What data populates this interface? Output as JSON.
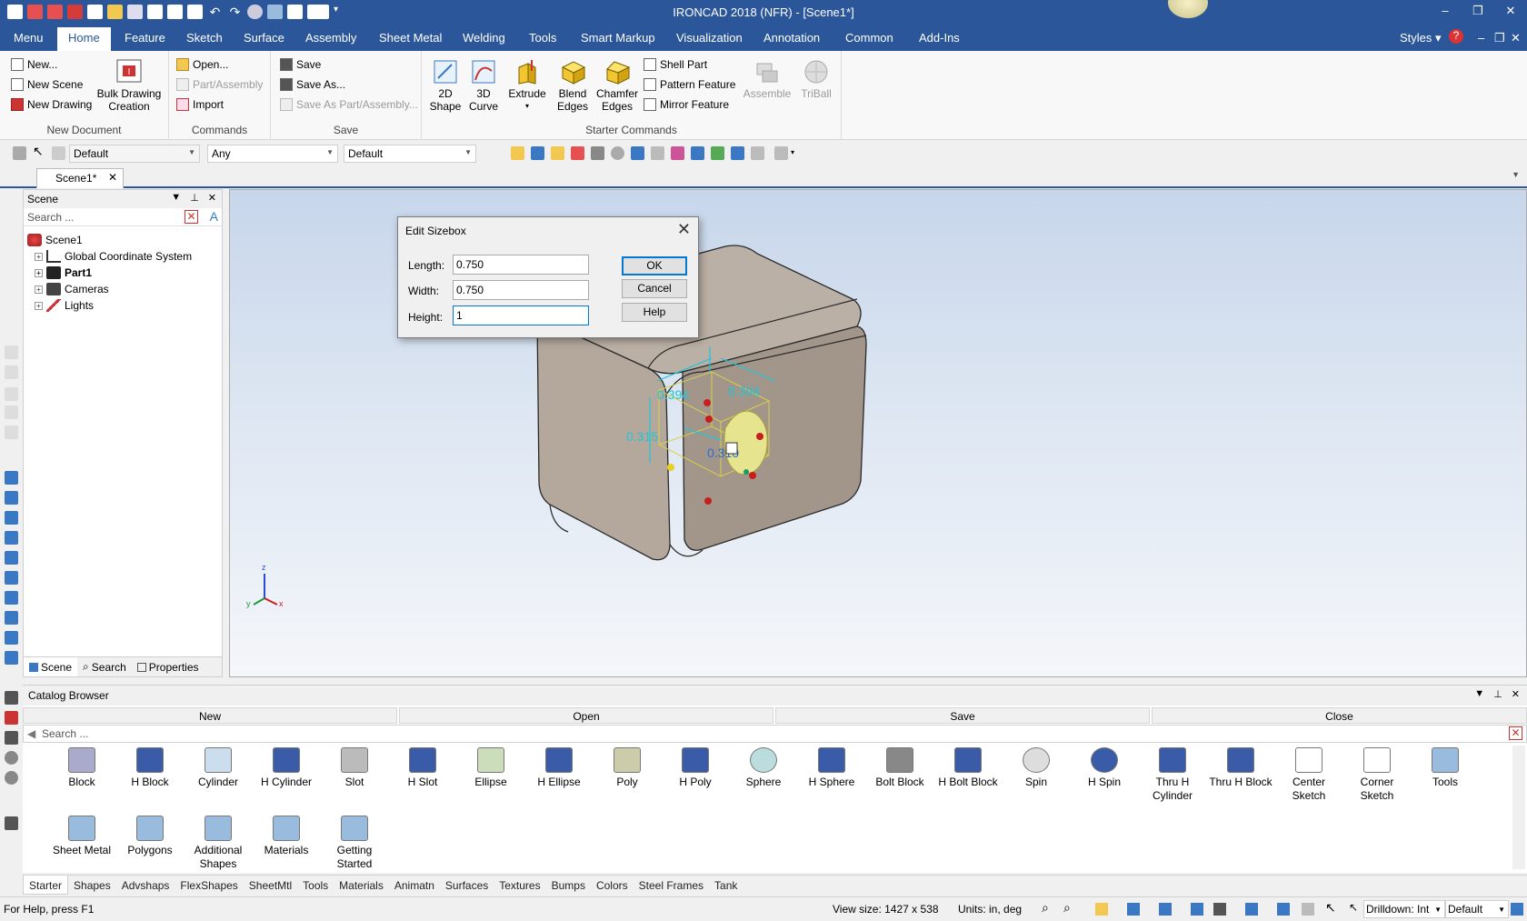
{
  "window": {
    "title": "IRONCAD 2018 (NFR) - [Scene1*]",
    "controls": [
      "–",
      "❐",
      "✕"
    ]
  },
  "quick_access_icons": [
    "new-icon",
    "open-icon",
    "save-icon",
    "print-icon",
    "undo-icon",
    "redo-icon",
    "triball-icon",
    "more-icon"
  ],
  "menu_tabs": [
    "Menu",
    "Home",
    "Feature",
    "Sketch",
    "Surface",
    "Assembly",
    "Sheet Metal",
    "Welding",
    "Tools",
    "Smart Markup",
    "Visualization",
    "Annotation",
    "Common",
    "Add-Ins"
  ],
  "menu_right": {
    "styles": "Styles"
  },
  "ribbon": {
    "new_document": {
      "label": "New Document",
      "new": "New...",
      "new_scene": "New Scene",
      "new_drawing": "New Drawing",
      "bulk_drawing_1": "Bulk Drawing",
      "bulk_drawing_2": "Creation"
    },
    "commands": {
      "label": "Commands",
      "open": "Open...",
      "part_assembly": "Part/Assembly",
      "import": "Import"
    },
    "save": {
      "label": "Save",
      "save": "Save",
      "save_as": "Save As...",
      "save_as_part": "Save As Part/Assembly..."
    },
    "starter": {
      "label": "Starter Commands",
      "shape2d_1": "2D",
      "shape2d_2": "Shape",
      "curve3d_1": "3D",
      "curve3d_2": "Curve",
      "extrude": "Extrude",
      "blend_1": "Blend",
      "blend_2": "Edges",
      "chamfer_1": "Chamfer",
      "chamfer_2": "Edges",
      "shell_part": "Shell Part",
      "pattern_feature": "Pattern Feature",
      "mirror_feature": "Mirror Feature",
      "assemble": "Assemble",
      "triball": "TriBall"
    }
  },
  "toolbar2": {
    "combo1": "Default",
    "combo2": "Any",
    "combo3": "Default"
  },
  "doc_tab": {
    "label": "Scene1*"
  },
  "scene_panel": {
    "title": "Scene",
    "search_placeholder": "Search ...",
    "tree": [
      "Scene1",
      "Global Coordinate System",
      "Part1",
      "Cameras",
      "Lights"
    ],
    "bottom_tabs": [
      "Scene",
      "Search",
      "Properties"
    ]
  },
  "viewport": {
    "dimensions": [
      "0.394",
      "0.394",
      "0.315",
      "0.310"
    ]
  },
  "dialog": {
    "title": "Edit Sizebox",
    "length_label": "Length:",
    "length_value": "0.750",
    "width_label": "Width:",
    "width_value": "0.750",
    "height_label": "Height:",
    "height_value": "1",
    "ok": "OK",
    "cancel": "Cancel",
    "help": "Help"
  },
  "catalog": {
    "title": "Catalog Browser",
    "new": "New",
    "open": "Open",
    "save": "Save",
    "close": "Close",
    "search_placeholder": "Search ...",
    "items": [
      [
        "Block",
        ""
      ],
      [
        "H Block",
        ""
      ],
      [
        "Cylinder",
        ""
      ],
      [
        "H Cylinder",
        ""
      ],
      [
        "Slot",
        ""
      ],
      [
        "H Slot",
        ""
      ],
      [
        "Ellipse",
        ""
      ],
      [
        "H Ellipse",
        ""
      ],
      [
        "Poly",
        ""
      ],
      [
        "H Poly",
        ""
      ],
      [
        "Sphere",
        ""
      ],
      [
        "H Sphere",
        ""
      ],
      [
        "Bolt Block",
        ""
      ],
      [
        "H Bolt Block",
        ""
      ],
      [
        "Spin",
        ""
      ],
      [
        "H Spin",
        ""
      ],
      [
        "Thru H",
        "Cylinder"
      ],
      [
        "Thru H Block",
        ""
      ],
      [
        "Center",
        "Sketch"
      ],
      [
        "Corner",
        "Sketch"
      ],
      [
        "Tools",
        ""
      ],
      [
        "Sheet Metal",
        ""
      ],
      [
        "Polygons",
        ""
      ],
      [
        "Additional",
        "Shapes"
      ],
      [
        "Materials",
        ""
      ],
      [
        "Getting",
        "Started"
      ]
    ],
    "tabs": [
      "Starter",
      "Shapes",
      "Advshaps",
      "FlexShapes",
      "SheetMtl",
      "Tools",
      "Materials",
      "Animatn",
      "Surfaces",
      "Textures",
      "Bumps",
      "Colors",
      "Steel Frames",
      "Tank"
    ]
  },
  "status": {
    "help": "For Help, press F1",
    "view_size": "View size: 1427 x  538",
    "units": "Units: in, deg",
    "drilldown": "Drilldown: Int",
    "default": "Default"
  },
  "colors": {
    "accent": "#2b579a",
    "dimension": "#1ec6d8",
    "part": "#a89a8c"
  }
}
